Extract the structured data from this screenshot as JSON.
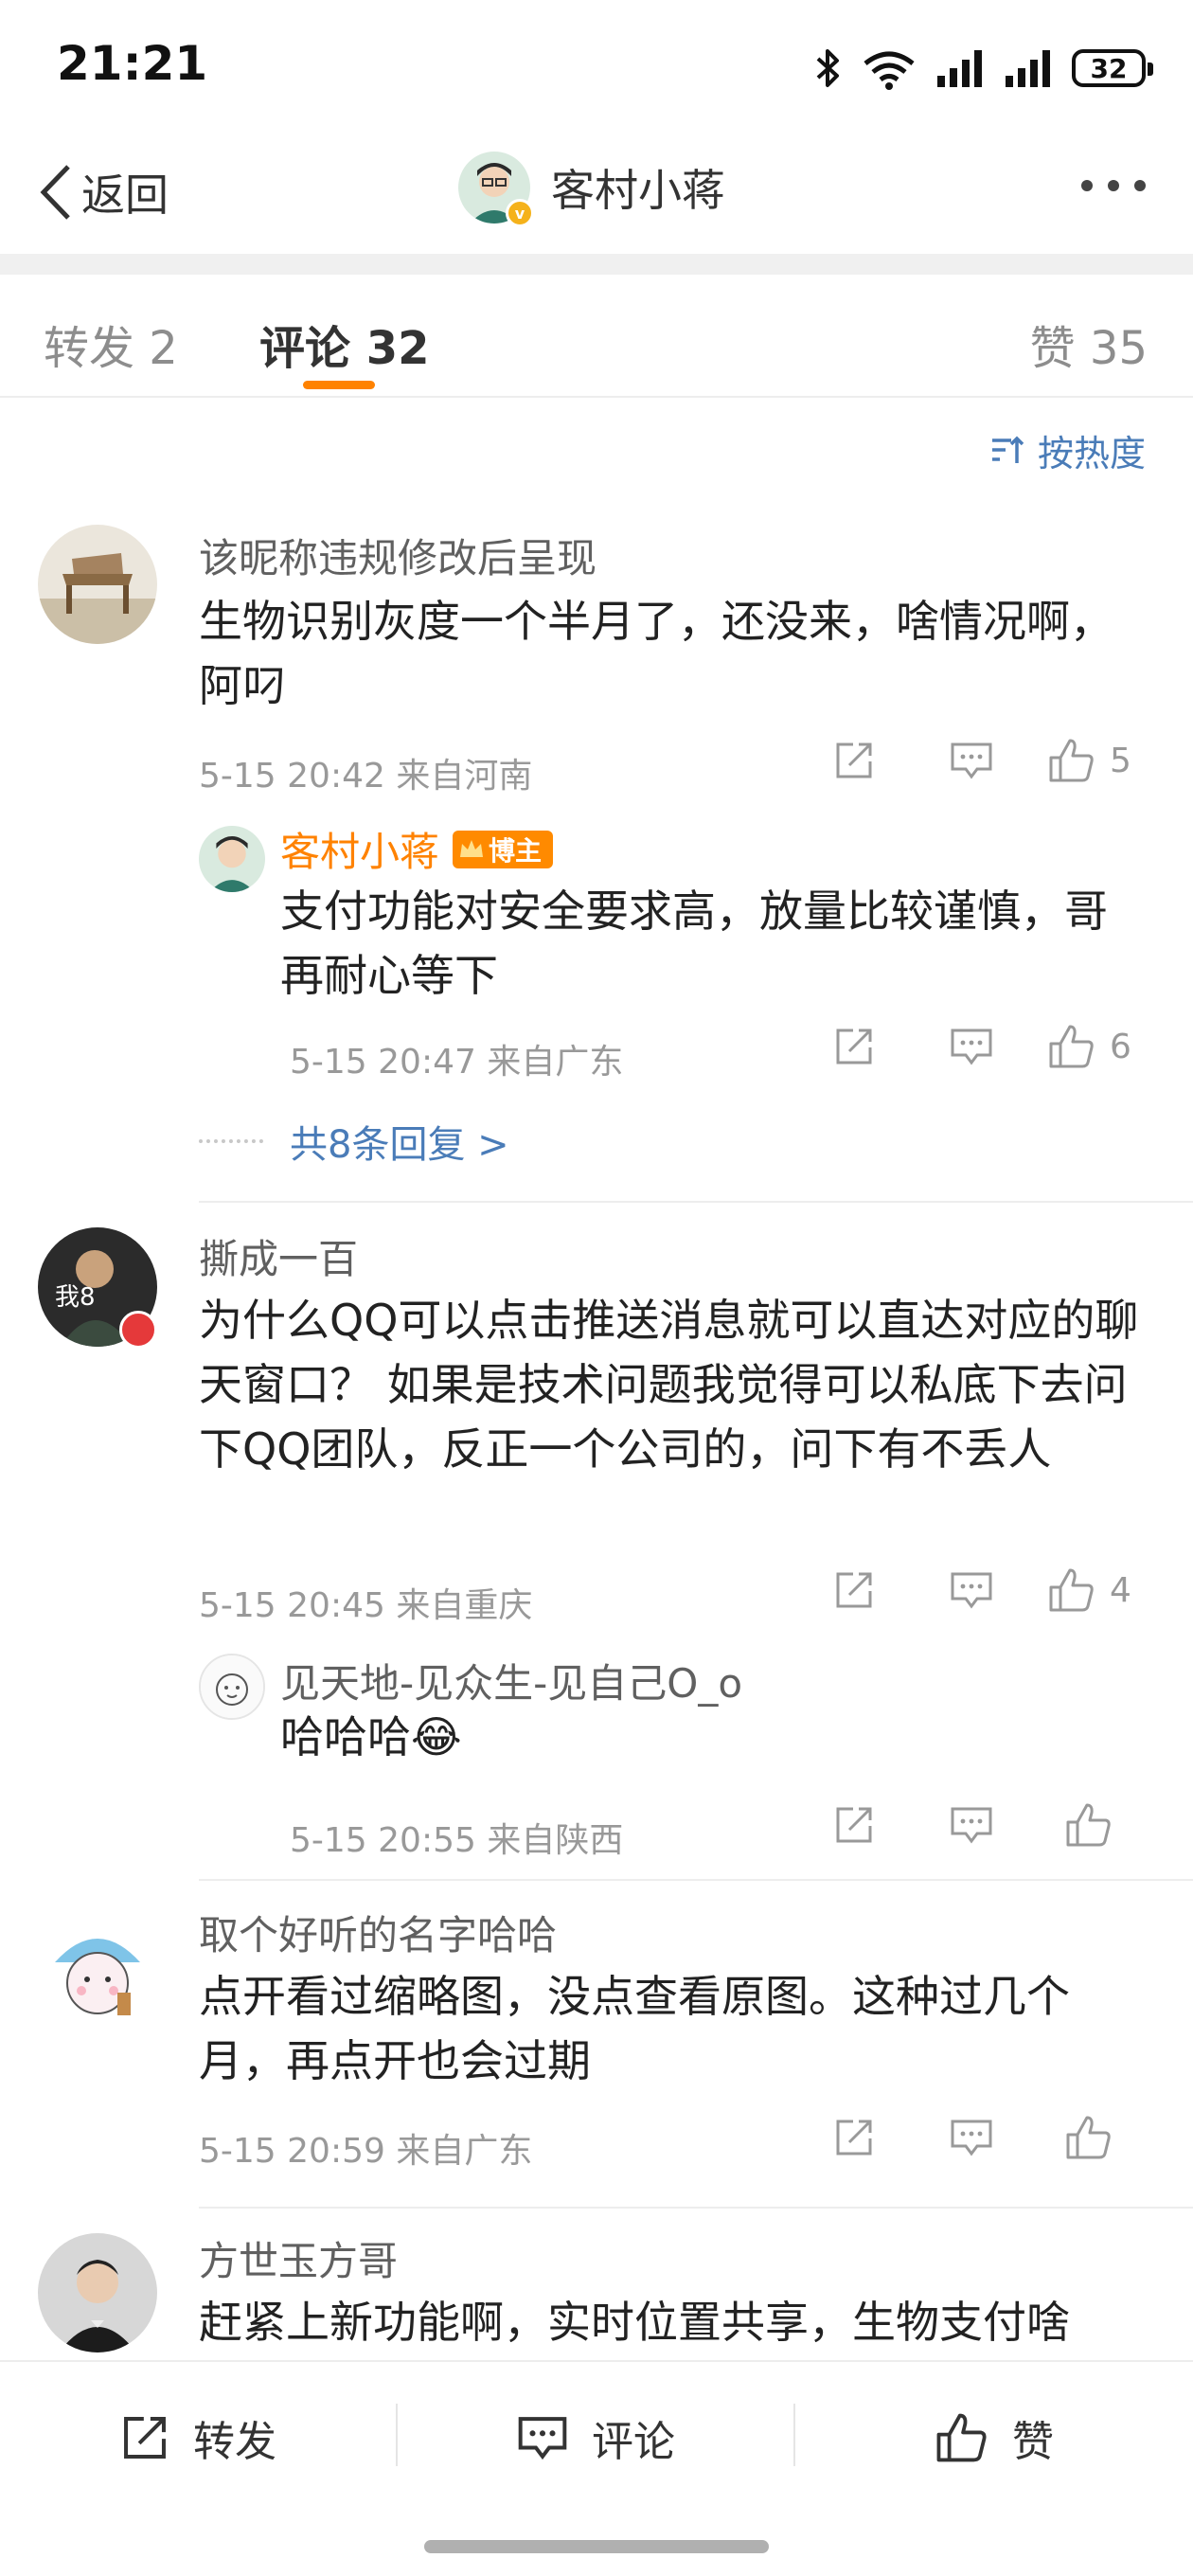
{
  "status_bar": {
    "time": "21:21",
    "battery": "32"
  },
  "nav": {
    "back_label": "返回",
    "title": "客村小蒋"
  },
  "tabs": [
    {
      "label": "转发 2"
    },
    {
      "label": "评论 32"
    },
    {
      "label": "赞 35"
    }
  ],
  "sort_label": "按热度",
  "comments": [
    {
      "name": "该昵称违规修改后呈现",
      "text": "生物识别灰度一个半月了，还没来，啥情况啊，阿叼",
      "meta": "5-15 20:42 来自河南",
      "likes": "5",
      "reply": {
        "name": "客村小蒋",
        "tag": "博主",
        "text": "支付功能对安全要求高，放量比较谨慎，哥再耐心等下",
        "meta": "5-15 20:47 来自广东",
        "likes": "6"
      },
      "more_replies": "共8条回复 >"
    },
    {
      "name": "撕成一百",
      "text": "为什么QQ可以点击推送消息就可以直达对应的聊天窗口？  如果是技术问题我觉得可以私底下去问下QQ团队，反正一个公司的，问下有不丢人",
      "meta": "5-15 20:45 来自重庆",
      "likes": "4",
      "reply": {
        "name": "见天地-见众生-见自己O_o",
        "text": "哈哈哈😂",
        "meta": "5-15 20:55 来自陕西"
      }
    },
    {
      "name": "取个好听的名字哈哈",
      "text": "点开看过缩略图，没点查看原图。这种过几个月，再点开也会过期",
      "meta": "5-15 20:59 来自广东"
    },
    {
      "name": "方世玉方哥",
      "text": "赶紧上新功能啊，实时位置共享，生物支付啥"
    }
  ],
  "bottom_bar": {
    "repost": "转发",
    "comment": "评论",
    "like": "赞"
  },
  "colors": {
    "accent": "#ff8200",
    "link": "#4a7cb8",
    "blogger_name": "#ff8200"
  }
}
